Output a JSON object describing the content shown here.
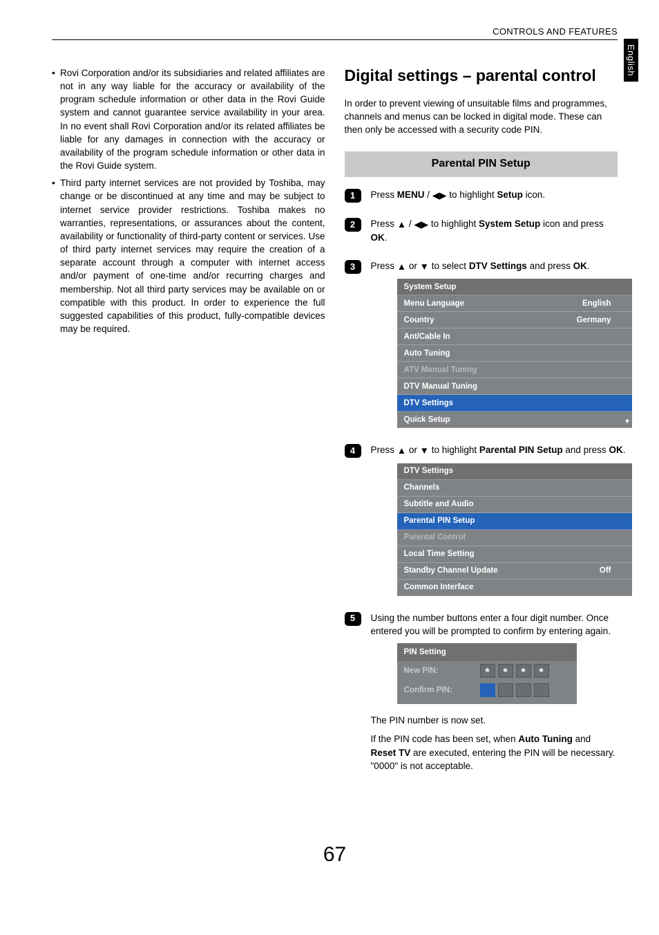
{
  "header": {
    "section": "CONTROLS AND FEATURES",
    "lang_tab": "English"
  },
  "left": {
    "bullets": [
      "Rovi Corporation and/or its subsidiaries and related affiliates are not in any way liable for the accuracy or availability of the program schedule information or other data in the Rovi Guide system and cannot guarantee service availability in your area. In no event shall Rovi Corporation and/or its related affiliates be liable for any damages in connection with the accuracy or availability of the program schedule information or other data in the Rovi Guide system.",
      "Third party internet services are not provided by Toshiba, may change or be discontinued at any time and may be subject to internet service provider restrictions. Toshiba makes no warranties, representations, or assurances about the content, availability or functionality of third-party content or services. Use of third party internet services may require the creation of a separate account through a computer with internet access and/or payment of one-time and/or recurring charges and membership. Not all third party services may be available on or compatible with this product. In order to experience the full suggested capabilities of this product, fully-compatible devices may be required."
    ]
  },
  "right": {
    "title": "Digital settings – parental control",
    "intro": "In order to prevent viewing of unsuitable films and programmes, channels and menus can be locked in digital mode. These can then only be accessed with a security code PIN.",
    "section_band": "Parental PIN Setup",
    "steps": {
      "s1": {
        "pre": "Press ",
        "b1": "MENU",
        "mid": " / ",
        "post": " to highlight ",
        "b2": "Setup",
        "end": " icon."
      },
      "s2": {
        "pre": "Press ",
        "mid": " / ",
        "post": " to highlight ",
        "b1": "System Setup",
        "end": " icon and press ",
        "b2": "OK",
        "dot": "."
      },
      "s3": {
        "pre": "Press ",
        "mid": " or ",
        "post": " to select ",
        "b1": "DTV Settings",
        "end": " and press ",
        "b2": "OK",
        "dot": "."
      },
      "s4": {
        "pre": "Press ",
        "mid": " or ",
        "post": " to highlight ",
        "b1": "Parental PIN Setup",
        "end": " and press ",
        "b2": "OK",
        "dot": "."
      },
      "s5": "Using the number buttons enter a four digit number. Once entered you will be prompted to confirm by entering again.",
      "s5_after": "The PIN number is now set.",
      "s5_note_pre": "If the PIN code has been set, when ",
      "s5_note_b1": "Auto Tuning",
      "s5_note_mid": " and ",
      "s5_note_b2": "Reset TV",
      "s5_note_post": " are executed, entering the PIN will be necessary. \"0000\" is not acceptable."
    },
    "osd1": {
      "title": "System Setup",
      "rows": [
        {
          "label": "Menu Language",
          "value": "English",
          "cls": "osd-item"
        },
        {
          "label": "Country",
          "value": "Germany",
          "cls": "osd-item"
        },
        {
          "label": "Ant/Cable In",
          "value": "",
          "cls": "osd-item"
        },
        {
          "label": "Auto Tuning",
          "value": "",
          "cls": "osd-item"
        },
        {
          "label": "ATV Manual Tuning",
          "value": "",
          "cls": "osd-dim"
        },
        {
          "label": "DTV Manual Tuning",
          "value": "",
          "cls": "osd-item"
        },
        {
          "label": "DTV Settings",
          "value": "",
          "cls": "osd-sel"
        },
        {
          "label": "Quick Setup",
          "value": "",
          "cls": "osd-item osd-scroll"
        }
      ]
    },
    "osd2": {
      "title": "DTV Settings",
      "rows": [
        {
          "label": "Channels",
          "value": "",
          "cls": "osd-item"
        },
        {
          "label": "Subtitle and Audio",
          "value": "",
          "cls": "osd-item"
        },
        {
          "label": "Parental PIN Setup",
          "value": "",
          "cls": "osd-sel"
        },
        {
          "label": "Parental Control",
          "value": "",
          "cls": "osd-dim"
        },
        {
          "label": "Local Time Setting",
          "value": "",
          "cls": "osd-item"
        },
        {
          "label": "Standby Channel Update",
          "value": "Off",
          "cls": "osd-item"
        },
        {
          "label": "Common Interface",
          "value": "",
          "cls": "osd-item"
        }
      ]
    },
    "pin": {
      "title": "PIN Setting",
      "new": "New PIN:",
      "confirm": "Confirm PIN:"
    }
  },
  "page_number": "67"
}
